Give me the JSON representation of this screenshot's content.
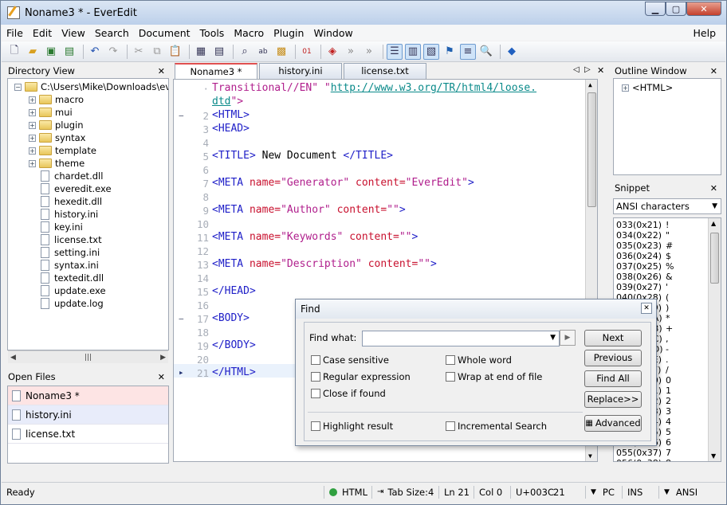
{
  "window": {
    "title": "Noname3 * - EverEdit"
  },
  "menu": [
    "File",
    "Edit",
    "View",
    "Search",
    "Document",
    "Tools",
    "Macro",
    "Plugin",
    "Window"
  ],
  "menu_help": "Help",
  "toolbar_icons": [
    "new-file-icon",
    "open-folder-icon",
    "save-icon",
    "save-all-icon",
    "undo-icon",
    "redo-icon",
    "cut-icon",
    "copy-icon",
    "paste-icon",
    "print-preview-icon",
    "print-icon",
    "find-icon",
    "replace-icon",
    "find-in-files-icon",
    "hex-icon",
    "macro-record-icon",
    "macro-play-icon",
    "macro-repeat-icon",
    "directory-view-icon",
    "outline-view-icon",
    "snippet-view-icon",
    "bookmark-icon",
    "word-wrap-icon",
    "zoom-icon",
    "plugin-icon"
  ],
  "directory": {
    "title": "Directory View",
    "root": "C:\\Users\\Mike\\Downloads\\everedit",
    "folders": [
      "macro",
      "mui",
      "plugin",
      "syntax",
      "template",
      "theme"
    ],
    "files": [
      "chardet.dll",
      "everedit.exe",
      "hexedit.dll",
      "history.ini",
      "key.ini",
      "license.txt",
      "setting.ini",
      "syntax.ini",
      "textedit.dll",
      "update.exe",
      "update.log"
    ]
  },
  "open_files": {
    "title": "Open Files",
    "items": [
      "Noname3 *",
      "history.ini",
      "license.txt"
    ]
  },
  "tabs": [
    "Noname3 *",
    "history.ini",
    "license.txt"
  ],
  "code": {
    "line0a": "Transitional//EN\" \"",
    "line0url": "http://www.w3.org/TR/html4/loose.",
    "line0b": "dtd",
    "line0c": "\">",
    "l2": "<HTML>",
    "l3": "<HEAD>",
    "l5a": "<TITLE>",
    "l5b": " New Document ",
    "l5c": "</TITLE>",
    "meta": "<META",
    "name_attr": "name=",
    "content_attr": "content=",
    "gen": "\"Generator\"",
    "ever": "\"EverEdit\"",
    "author": "\"Author\"",
    "keywords": "\"Keywords\"",
    "desc": "\"Description\"",
    "empty": "\"\"",
    "close": ">",
    "l15": "</HEAD>",
    "l17": "<BODY>",
    "l19": "</BODY>",
    "l21": "</HTML>",
    "line_numbers": [
      "2",
      "3",
      "4",
      "5",
      "6",
      "7",
      "8",
      "9",
      "10",
      "11",
      "12",
      "13",
      "14",
      "15",
      "16",
      "17",
      "18",
      "19",
      "20",
      "21"
    ]
  },
  "outline": {
    "title": "Outline Window",
    "root": "<HTML>"
  },
  "snippet": {
    "title": "Snippet",
    "selected": "ANSI characters",
    "rows": [
      [
        "033(0x21)",
        "!"
      ],
      [
        "034(0x22)",
        "\""
      ],
      [
        "035(0x23)",
        "#"
      ],
      [
        "036(0x24)",
        "$"
      ],
      [
        "037(0x25)",
        "%"
      ],
      [
        "038(0x26)",
        "&"
      ],
      [
        "039(0x27)",
        "'"
      ],
      [
        "040(0x28)",
        "("
      ],
      [
        "041(0x29)",
        ")"
      ],
      [
        "042(0x2A)",
        "*"
      ],
      [
        "043(0x2B)",
        "+"
      ],
      [
        "044(0x2C)",
        ","
      ],
      [
        "045(0x2D)",
        "-"
      ],
      [
        "046(0x2E)",
        "."
      ],
      [
        "047(0x2F)",
        "/"
      ],
      [
        "048(0x30)",
        "0"
      ],
      [
        "049(0x31)",
        "1"
      ],
      [
        "050(0x32)",
        "2"
      ],
      [
        "051(0x33)",
        "3"
      ],
      [
        "052(0x34)",
        "4"
      ],
      [
        "053(0x35)",
        "5"
      ],
      [
        "054(0x36)",
        "6"
      ],
      [
        "055(0x37)",
        "7"
      ],
      [
        "056(0x38)",
        "8"
      ]
    ]
  },
  "find": {
    "title": "Find",
    "label": "Find what:",
    "value": "",
    "case": "Case sensitive",
    "regex": "Regular expression",
    "close_found": "Close if found",
    "whole": "Whole word",
    "wrap": "Wrap at end of file",
    "highlight": "Highlight result",
    "incremental": "Incremental Search",
    "next": "Next",
    "previous": "Previous",
    "find_all": "Find All",
    "replace": "Replace>>",
    "advanced": "Advanced"
  },
  "status": {
    "ready": "Ready",
    "lang": "HTML",
    "tab": "Tab Size:4",
    "ln": "Ln 21",
    "col": "Col 0",
    "code": "U+003C",
    "num": "21",
    "eol": "PC",
    "ins": "INS",
    "enc": "ANSI"
  }
}
